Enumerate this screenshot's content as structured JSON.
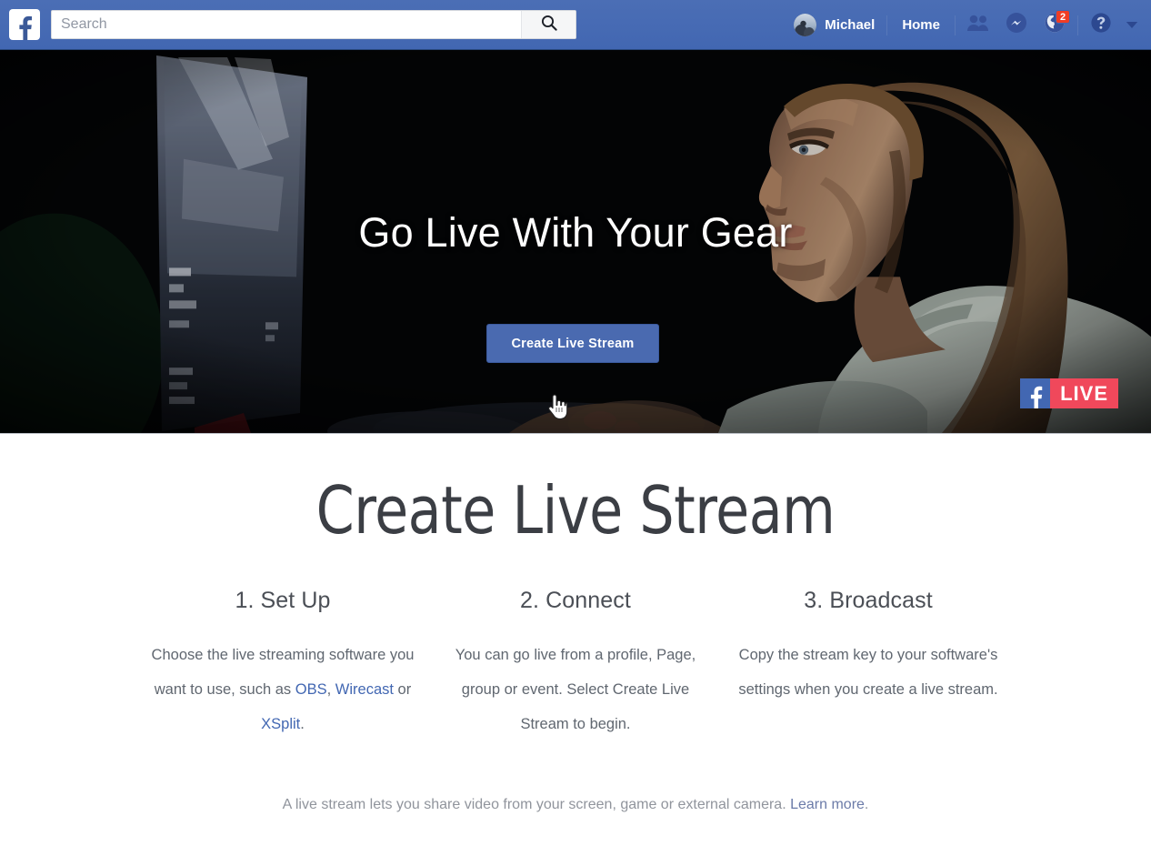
{
  "navbar": {
    "logo_icon": "facebook-f-logo",
    "search": {
      "value": "",
      "placeholder": "Search",
      "button_icon": "search-icon"
    },
    "profile": {
      "name": "Michael",
      "avatar_icon": "user-avatar-photo"
    },
    "home_label": "Home",
    "icons": [
      {
        "name": "friend-requests-icon",
        "badge": ""
      },
      {
        "name": "messenger-icon",
        "badge": ""
      },
      {
        "name": "notifications-globe-icon",
        "badge": "2"
      },
      {
        "name": "help-icon",
        "badge": ""
      }
    ],
    "account_menu_icon": "chevron-down-icon",
    "colors": {
      "bar": "#4267b2",
      "badge": "#f03d25",
      "icon": "#36529b"
    }
  },
  "hero": {
    "title": "Go Live With Your Gear",
    "cta_label": "Create Live Stream",
    "live_badge": {
      "brand_icon": "facebook-f-logo",
      "label": "LIVE",
      "color": "#f0485b"
    },
    "cursor_icon": "pointing-hand-cursor"
  },
  "main": {
    "page_title": "Create Live Stream",
    "steps": [
      {
        "heading": "1. Set Up",
        "body_prefix": "Choose the live streaming software you want to use, such as ",
        "links": [
          {
            "label": "OBS",
            "after": ", "
          },
          {
            "label": "Wirecast",
            "after": " or "
          },
          {
            "label": "XSplit",
            "after": "."
          }
        ]
      },
      {
        "heading": "2. Connect",
        "body": "You can go live from a profile, Page, group or event. Select Create Live Stream to begin."
      },
      {
        "heading": "3. Broadcast",
        "body": "Copy the stream key to your software's settings when you create a live stream."
      }
    ],
    "footnote": {
      "text": "A live stream lets you share video from your screen, game or external camera.",
      "link_label": "Learn more",
      "suffix": "."
    }
  }
}
